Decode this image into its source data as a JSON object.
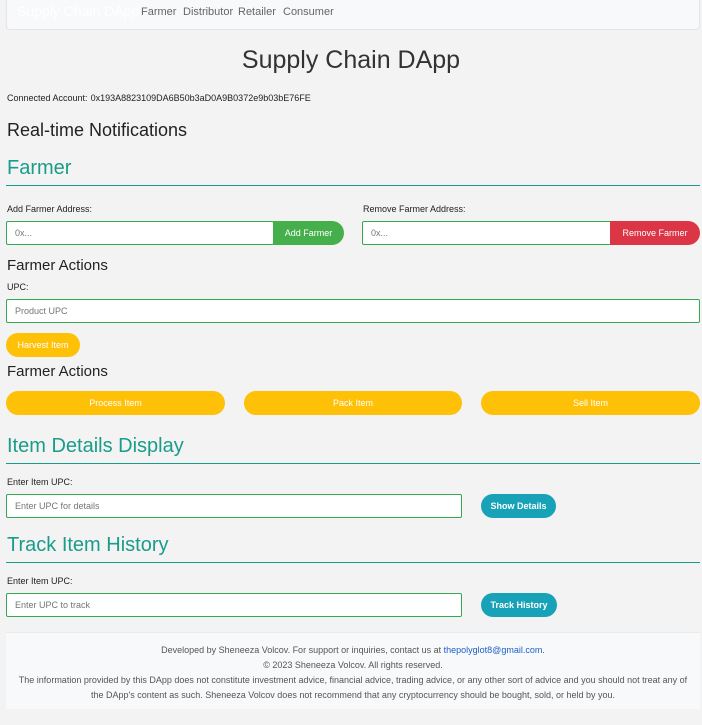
{
  "navbar": {
    "brand": "Supply Chain DApp",
    "links": [
      "Farmer",
      "Distributor",
      "Retailer",
      "Consumer"
    ]
  },
  "page_title": "Supply Chain DApp",
  "account": {
    "label": "Connected Account:",
    "address": "0x193A8823109DA6B50b3aD0A9B0372e9b03bE76FE"
  },
  "notifications_heading": "Real-time Notifications",
  "farmer": {
    "heading": "Farmer",
    "add_label": "Add Farmer Address:",
    "add_placeholder": "0x...",
    "add_button": "Add Farmer",
    "remove_label": "Remove Farmer Address:",
    "remove_placeholder": "0x...",
    "remove_button": "Remove Farmer",
    "actions_heading_1": "Farmer Actions",
    "upc_label": "UPC:",
    "upc_placeholder": "Product UPC",
    "harvest_button": "Harvest Item",
    "actions_heading_2": "Farmer Actions",
    "process_button": "Process Item",
    "pack_button": "Pack Item",
    "sell_button": "Sell Item"
  },
  "item_details": {
    "heading": "Item Details Display",
    "label": "Enter Item UPC:",
    "placeholder": "Enter UPC for details",
    "button": "Show Details"
  },
  "track_history": {
    "heading": "Track Item History",
    "label": "Enter Item UPC:",
    "placeholder": "Enter UPC to track",
    "button": "Track History"
  },
  "footer": {
    "line1_prefix": "Developed by Sheneeza Volcov. For support or inquiries, contact us at ",
    "email": "thepolyglot8@gmail.com",
    "line1_suffix": ".",
    "line2": "© 2023 Sheneeza Volcov. All rights reserved.",
    "line3": "The information provided by this DApp does not constitute investment advice, financial advice, trading advice, or any other sort of advice and you should not treat any of the DApp's content as such. Sheneeza Volcov does not recommend that any cryptocurrency should be bought, sold, or held by you."
  },
  "colors": {
    "accent_teal": "#1a9c8a",
    "green": "#45b04b",
    "red": "#dc3545",
    "yellow": "#ffc107",
    "info": "#17a2b8"
  }
}
